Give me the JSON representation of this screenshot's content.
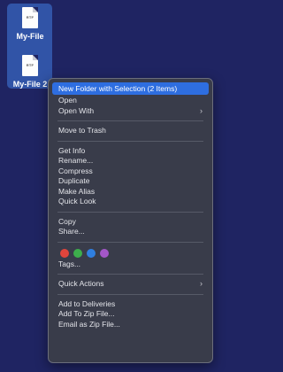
{
  "desktop": {
    "files": [
      {
        "name": "My-File",
        "ext": "RTF"
      },
      {
        "name": "My-File 2",
        "ext": "RTF"
      }
    ]
  },
  "menu": {
    "highlighted": "New Folder with Selection (2 Items)",
    "group1": [
      "Open",
      "Open With"
    ],
    "group2": [
      "Move to Trash"
    ],
    "group3": [
      "Get Info",
      "Rename...",
      "Compress",
      "Duplicate",
      "Make Alias",
      "Quick Look"
    ],
    "group4": [
      "Copy",
      "Share..."
    ],
    "tag_colors": [
      "#e0453c",
      "#3dae4c",
      "#2f7fe0",
      "#a457c8"
    ],
    "tags_label": "Tags...",
    "quick_actions": "Quick Actions",
    "group6": [
      "Add to Deliveries",
      "Add To Zip File...",
      "Email as Zip File..."
    ]
  }
}
